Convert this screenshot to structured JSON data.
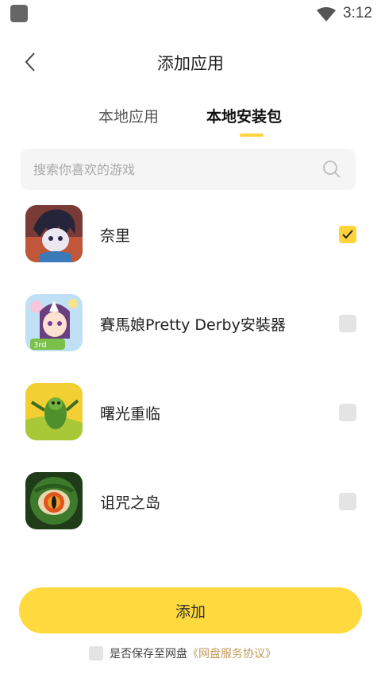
{
  "status_bar": {
    "time": "3:12",
    "icons": [
      "notification-icon",
      "wifi-icon"
    ]
  },
  "header": {
    "title": "添加应用",
    "back_icon": "chevron-left-icon"
  },
  "tabs": [
    {
      "label": "本地应用",
      "active": false
    },
    {
      "label": "本地安装包",
      "active": true
    }
  ],
  "colors": {
    "accent": "#ffd43b",
    "button": "#ffd93d",
    "link": "#c29a5a",
    "checkbox_off": "#e4e4e4"
  },
  "search": {
    "placeholder": "搜索你喜欢的游戏",
    "value": "",
    "icon": "search-icon"
  },
  "apps": [
    {
      "name": "奈里",
      "checked": true
    },
    {
      "name": "賽馬娘Pretty Derby安裝器",
      "checked": false
    },
    {
      "name": "曙光重临",
      "checked": false
    },
    {
      "name": "诅咒之岛",
      "checked": false
    }
  ],
  "add_button": {
    "label": "添加"
  },
  "footer": {
    "text": "是否保存至网盘",
    "link": "《网盘服务协议》",
    "checked": false
  }
}
